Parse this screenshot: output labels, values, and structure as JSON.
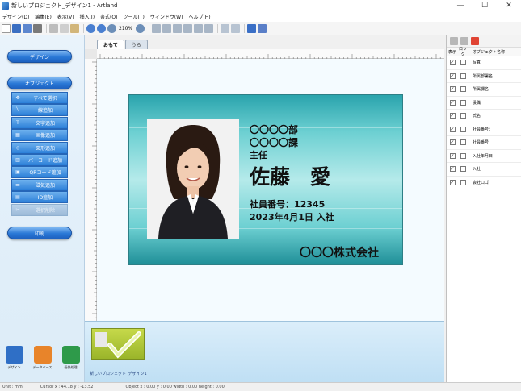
{
  "window": {
    "title": "新しいプロジェクト_デザイン1 - Artland",
    "minimize": "—",
    "maximize": "☐",
    "close": "✕"
  },
  "menu": [
    "デザイン(D)",
    "編集(E)",
    "表示(V)",
    "挿入(I)",
    "書式(O)",
    "ツール(T)",
    "ウィンドウ(W)",
    "ヘルプ(H)"
  ],
  "toolbar": {
    "zoom": "210%"
  },
  "left_panel": {
    "design_button": "デザイン",
    "object_button": "オブジェクト",
    "tools": [
      {
        "icon": "✥",
        "label": "すべて選択",
        "icon_name": "select-all-icon"
      },
      {
        "icon": "╲",
        "label": "線追加",
        "icon_name": "line-icon"
      },
      {
        "icon": "T",
        "label": "文字追加",
        "icon_name": "text-icon"
      },
      {
        "icon": "▦",
        "label": "画像追加",
        "icon_name": "image-icon"
      },
      {
        "icon": "◇",
        "label": "図形追加",
        "icon_name": "shape-icon"
      },
      {
        "icon": "▥",
        "label": "バーコード追加",
        "icon_name": "barcode-icon"
      },
      {
        "icon": "▣",
        "label": "QRコード追加",
        "icon_name": "qrcode-icon"
      },
      {
        "icon": "▬",
        "label": "磁気追加",
        "icon_name": "magnetic-icon"
      },
      {
        "icon": "▤",
        "label": "ID追加",
        "icon_name": "id-icon"
      },
      {
        "icon": "✂",
        "label": "選択削除",
        "icon_name": "delete-icon"
      }
    ],
    "print_button": "印刷",
    "apps": [
      {
        "label": "デザイン",
        "color": "#2f6fc6"
      },
      {
        "label": "データベース",
        "color": "#e8842a"
      },
      {
        "label": "画像処理",
        "color": "#2e9a4a"
      }
    ]
  },
  "tabs": [
    {
      "label": "おもて",
      "active": true
    },
    {
      "label": "うら",
      "active": false
    }
  ],
  "card": {
    "department": "〇〇〇〇部",
    "section": "〇〇〇〇課",
    "position": "主任",
    "name": "佐藤　愛",
    "employee_number": "社員番号：12345",
    "join_date": "2023年4月1日 入社",
    "company": "〇〇〇株式会社",
    "colors": {
      "accent": "#2aa4ad",
      "highlight": "#b5eaea"
    }
  },
  "thumbnails": [
    {
      "label": "新しいプロジェクト_デザイン1"
    }
  ],
  "right_panel": {
    "headers": {
      "show": "表示",
      "lock": "ロック",
      "name": "オブジェクト名称"
    },
    "objects": [
      {
        "name": "写真",
        "show": true,
        "lock": false
      },
      {
        "name": "所属部署名",
        "show": true,
        "lock": false
      },
      {
        "name": "所属課名",
        "show": true,
        "lock": false
      },
      {
        "name": "役職",
        "show": true,
        "lock": false
      },
      {
        "name": "氏名",
        "show": true,
        "lock": false
      },
      {
        "name": "社員番号：",
        "show": true,
        "lock": false
      },
      {
        "name": "社員番号",
        "show": true,
        "lock": false
      },
      {
        "name": "入社年月日",
        "show": true,
        "lock": false
      },
      {
        "name": "入社",
        "show": true,
        "lock": false
      },
      {
        "name": "会社ロゴ",
        "show": true,
        "lock": false
      }
    ]
  },
  "status": {
    "unit": "Unit : mm",
    "cursor": "Cursor  x : 44.18  y : -13.52",
    "object": "Object  x : 0.00  y : 0.00  width : 0.00  height : 0.00"
  }
}
